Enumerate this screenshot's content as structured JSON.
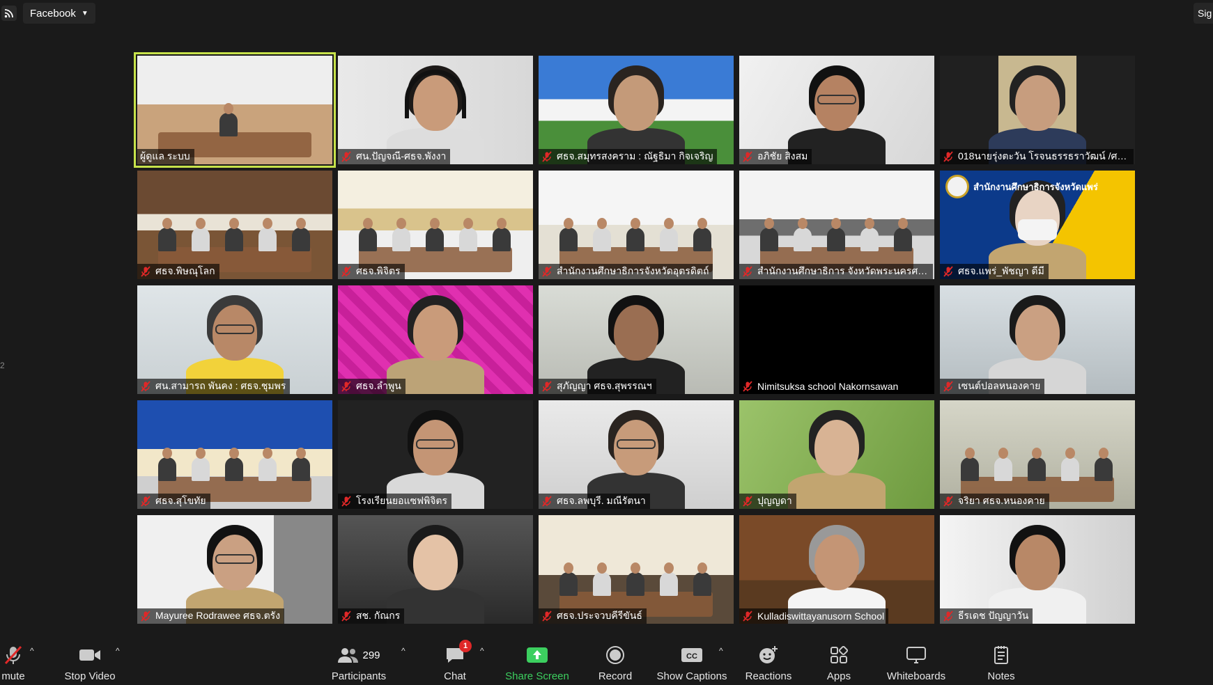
{
  "topbar": {
    "rss_icon": "rss-feed-icon",
    "livestream_label": "Facebook",
    "signin_label": "Sig"
  },
  "edge_text": "2",
  "tiles": [
    {
      "name": "ผู้ดูแล ระบบ",
      "muted": false,
      "active": true
    },
    {
      "name": "ศน.ปัญจณี-ศธจ.พังงา",
      "muted": true
    },
    {
      "name": "ศธจ.สมุทรสงคราม : ณัฐธิมา กิจเจริญ",
      "muted": true
    },
    {
      "name": "อภิชัย สิงสม",
      "muted": true
    },
    {
      "name": "018นายรุ่งตะวัน โรจนธรรธราวัฒน์ /ศธจ....",
      "muted": true
    },
    {
      "name": "ศธจ.พิษณุโลก",
      "muted": true
    },
    {
      "name": "ศธจ.พิจิตร",
      "muted": true
    },
    {
      "name": "สำนักงานศึกษาธิการจังหวัดอุตรดิตถ์",
      "muted": true
    },
    {
      "name": "สำนักงานศึกษาธิการ จังหวัดพระนครศรีอ...",
      "muted": true
    },
    {
      "name": "ศธจ.แพร่_พัชญา ดีมี",
      "muted": true,
      "banner": "สำนักงานศึกษาธิการจังหวัดแพร่"
    },
    {
      "name": "ศน.สามารถ พันคง : ศธจ.ชุมพร",
      "muted": true
    },
    {
      "name": "ศธจ.ลำพูน",
      "muted": true
    },
    {
      "name": "สุภัญญา ศธจ.สุพรรณฯ",
      "muted": true
    },
    {
      "name": "Nimitsuksa school Nakornsawan",
      "muted": true
    },
    {
      "name": "เซนต์ปอลหนองคาย",
      "muted": true
    },
    {
      "name": "ศธจ.สุโขทัย",
      "muted": true
    },
    {
      "name": "โรงเรียนยอแซฟพิจิตร",
      "muted": true
    },
    {
      "name": "ศธจ.ลพบุรี. มณีรัตนา",
      "muted": true
    },
    {
      "name": "ปุญญดา",
      "muted": true
    },
    {
      "name": "จริยา ศธจ.หนองคาย",
      "muted": true
    },
    {
      "name": "Mayuree Rodrawee ศธจ.ตรัง",
      "muted": true
    },
    {
      "name": "สช. กัณกร",
      "muted": true
    },
    {
      "name": "ศธจ.ประจวบคีรีขันธ์",
      "muted": true
    },
    {
      "name": "Kulladiswittayanusorn School",
      "muted": true
    },
    {
      "name": "ธีรเดช ปัญญาวัน",
      "muted": true
    }
  ],
  "toolbar": {
    "unmute": "mute",
    "stop_video": "Stop Video",
    "participants": "Participants",
    "participants_count": "299",
    "chat": "Chat",
    "chat_badge": "1",
    "share_screen": "Share Screen",
    "record": "Record",
    "show_captions": "Show Captions",
    "reactions": "Reactions",
    "apps": "Apps",
    "whiteboards": "Whiteboards",
    "notes": "Notes"
  },
  "colors": {
    "background": "#1a1a1a",
    "active_speaker": "#c7e24a",
    "muted_red": "#e02828",
    "share_green": "#3ccf5f"
  }
}
